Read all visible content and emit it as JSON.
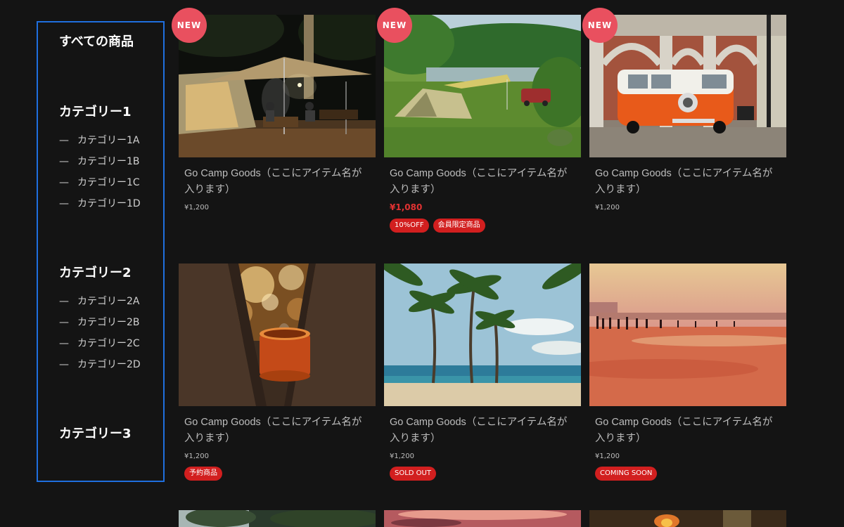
{
  "sidebar": {
    "all_label": "すべての商品",
    "dash": "—",
    "categories": [
      {
        "label": "カテゴリー1",
        "items": [
          "カテゴリー1A",
          "カテゴリー1B",
          "カテゴリー1C",
          "カテゴリー1D"
        ]
      },
      {
        "label": "カテゴリー2",
        "items": [
          "カテゴリー2A",
          "カテゴリー2B",
          "カテゴリー2C",
          "カテゴリー2D"
        ]
      },
      {
        "label": "カテゴリー3",
        "items": []
      }
    ]
  },
  "new_badge": "NEW",
  "products": [
    {
      "title": "Go Camp Goods（ここにアイテム名が入ります）",
      "price": "¥1,200",
      "new": true,
      "image": "night-camping-tent"
    },
    {
      "title": "Go Camp Goods（ここにアイテム名が入ります）",
      "price": "¥1,080",
      "sale": true,
      "new": true,
      "tags": [
        "10%OFF",
        "会員限定商品"
      ],
      "image": "lakeside-camp"
    },
    {
      "title": "Go Camp Goods（ここにアイテム名が入ります）",
      "price": "¥1,200",
      "new": true,
      "image": "orange-van"
    },
    {
      "title": "Go Camp Goods（ここにアイテム名が入ります）",
      "price": "¥1,200",
      "tags": [
        "予約商品"
      ],
      "image": "mug-in-tree"
    },
    {
      "title": "Go Camp Goods（ここにアイテム名が入ります）",
      "price": "¥1,200",
      "tags": [
        "SOLD OUT"
      ],
      "image": "palm-beach"
    },
    {
      "title": "Go Camp Goods（ここにアイテム名が入ります）",
      "price": "¥1,200",
      "tags": [
        "COMING SOON"
      ],
      "image": "sunset-beach"
    }
  ],
  "colors": {
    "background": "#141414",
    "sidebar_border": "#1f6fde",
    "new_badge": "#e9505f",
    "tag": "#d21f1f",
    "sale_price": "#e03232"
  }
}
